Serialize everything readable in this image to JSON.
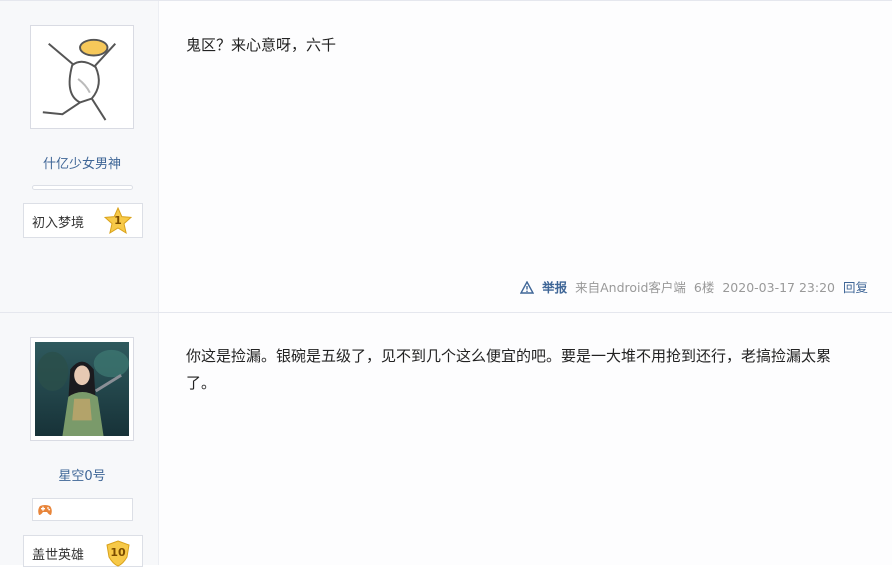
{
  "posts": [
    {
      "username": "什亿少女男神",
      "level_title": "初入梦境",
      "level_num": "1",
      "content": "鬼区？来心意呀，六千",
      "report_label": "举报",
      "source": "来自Android客户端",
      "floor": "6楼",
      "datetime": "2020-03-17 23:20",
      "reply_label": "回复"
    },
    {
      "username": "星空0号",
      "level_title": "盖世英雄",
      "level_num": "10",
      "content": "你这是捡漏。银碗是五级了，见不到几个这么便宜的吧。要是一大堆不用抢到还行，老搞捡漏太累了。"
    }
  ],
  "colors": {
    "link": "#3f6697",
    "star": "#f7c948",
    "sidebar": "#f7f8fa"
  },
  "icons": {
    "report": "warning-icon",
    "badge": "gamepad-icon",
    "level": "star-icon"
  }
}
